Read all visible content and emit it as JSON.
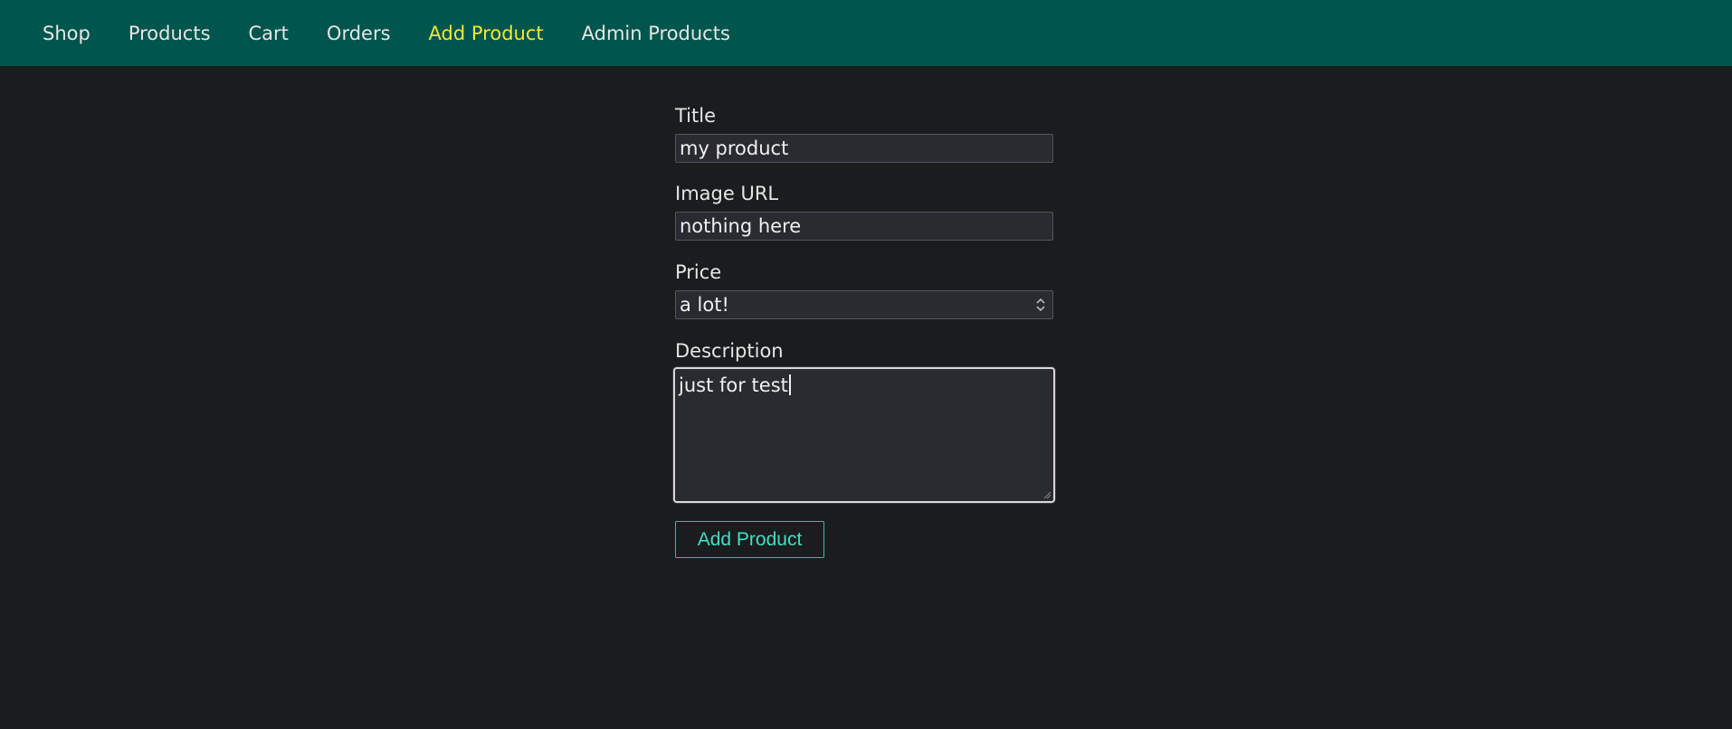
{
  "nav": {
    "items": [
      {
        "label": "Shop"
      },
      {
        "label": "Products"
      },
      {
        "label": "Cart"
      },
      {
        "label": "Orders"
      },
      {
        "label": "Add Product",
        "active": true
      },
      {
        "label": "Admin Products"
      }
    ]
  },
  "form": {
    "title_label": "Title",
    "title_value": "my product",
    "image_label": "Image URL",
    "image_value": "nothing here",
    "price_label": "Price",
    "price_value": "a lot!",
    "description_label": "Description",
    "description_value": "just for test",
    "submit_label": "Add Product"
  },
  "colors": {
    "header_bg": "#00554d",
    "page_bg": "#1b1c1e",
    "active_nav": "#f2e835",
    "accent": "#1ec9ad"
  },
  "icons": {
    "spinner": "up-down-arrows",
    "resize": "resize-grip"
  }
}
